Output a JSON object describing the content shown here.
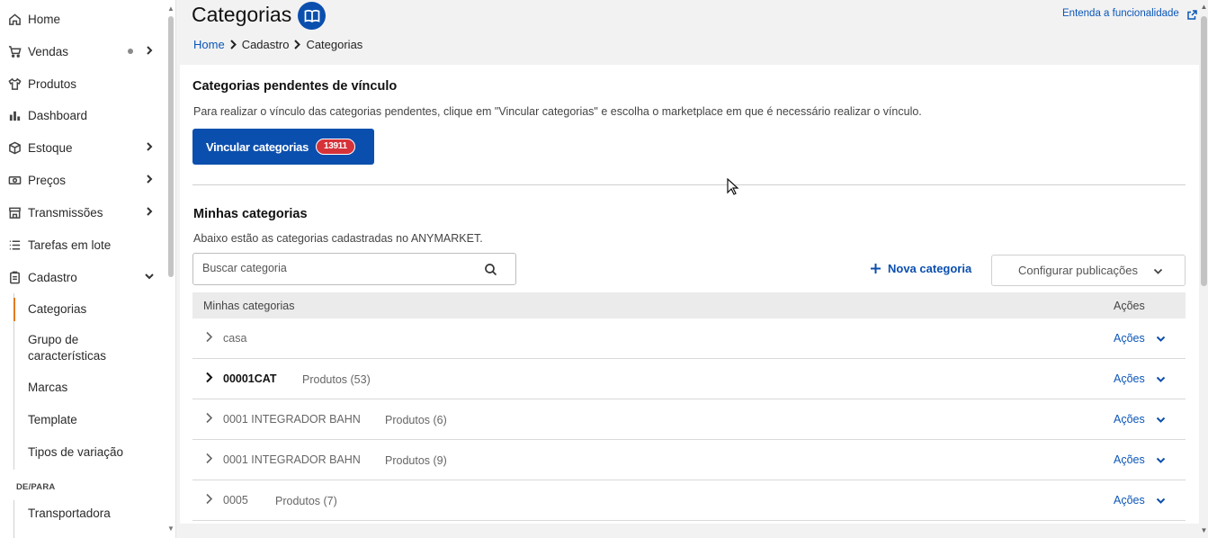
{
  "sidebar": {
    "items": [
      {
        "label": "Home",
        "icon": "home-icon"
      },
      {
        "label": "Vendas",
        "icon": "cart-icon"
      },
      {
        "label": "Produtos",
        "icon": "shirt-icon"
      },
      {
        "label": "Dashboard",
        "icon": "bar-chart-icon"
      },
      {
        "label": "Estoque",
        "icon": "box-icon"
      },
      {
        "label": "Preços",
        "icon": "money-icon"
      },
      {
        "label": "Transmissões",
        "icon": "store-icon"
      },
      {
        "label": "Tarefas em lote",
        "icon": "list-icon"
      },
      {
        "label": "Cadastro",
        "icon": "clipboard-icon"
      }
    ],
    "cadastro_sub": [
      "Categorias",
      "Grupo de características",
      "Marcas",
      "Template",
      "Tipos de variação"
    ],
    "section_label": "DE/PARA",
    "depara_sub": [
      "Transportadora"
    ]
  },
  "header": {
    "title": "Categorias",
    "help_link": "Entenda a funcionalidade",
    "breadcrumb": [
      "Home",
      "Cadastro",
      "Categorias"
    ]
  },
  "pending": {
    "title": "Categorias pendentes de vínculo",
    "description": "Para realizar o vínculo das categorias pendentes, clique em \"Vincular categorias\" e escolha o marketplace em que é necessário realizar o vínculo.",
    "button_label": "Vincular categorias",
    "badge_count": "13911"
  },
  "mine": {
    "title": "Minhas categorias",
    "description": "Abaixo estão as categorias cadastradas no ANYMARKET.",
    "search_placeholder": "Buscar categoria",
    "new_button": "Nova categoria",
    "config_button": "Configurar publicações"
  },
  "table": {
    "columns": [
      "Minhas categorias",
      "Ações"
    ],
    "rows": [
      {
        "name": "casa",
        "count": "",
        "action": "Ações"
      },
      {
        "name": "00001CAT",
        "count": "Produtos (53)",
        "action": "Ações"
      },
      {
        "name": "0001 INTEGRADOR BAHN",
        "count": "Produtos (6)",
        "action": "Ações"
      },
      {
        "name": "0001 INTEGRADOR BAHN",
        "count": "Produtos (9)",
        "action": "Ações"
      },
      {
        "name": "0005",
        "count": "Produtos (7)",
        "action": "Ações"
      }
    ]
  },
  "colors": {
    "primary": "#0b4fae",
    "badge": "#d6323a",
    "active_marker": "#e07b1f"
  }
}
